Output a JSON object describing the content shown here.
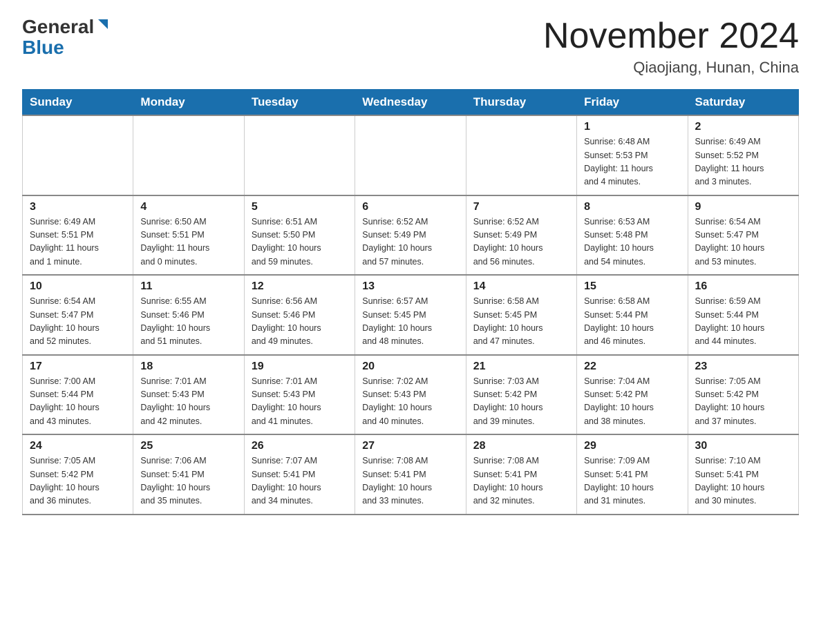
{
  "header": {
    "logo_general": "General",
    "logo_blue": "Blue",
    "month_title": "November 2024",
    "location": "Qiaojiang, Hunan, China"
  },
  "weekdays": [
    "Sunday",
    "Monday",
    "Tuesday",
    "Wednesday",
    "Thursday",
    "Friday",
    "Saturday"
  ],
  "weeks": [
    [
      {
        "day": "",
        "info": ""
      },
      {
        "day": "",
        "info": ""
      },
      {
        "day": "",
        "info": ""
      },
      {
        "day": "",
        "info": ""
      },
      {
        "day": "",
        "info": ""
      },
      {
        "day": "1",
        "info": "Sunrise: 6:48 AM\nSunset: 5:53 PM\nDaylight: 11 hours\nand 4 minutes."
      },
      {
        "day": "2",
        "info": "Sunrise: 6:49 AM\nSunset: 5:52 PM\nDaylight: 11 hours\nand 3 minutes."
      }
    ],
    [
      {
        "day": "3",
        "info": "Sunrise: 6:49 AM\nSunset: 5:51 PM\nDaylight: 11 hours\nand 1 minute."
      },
      {
        "day": "4",
        "info": "Sunrise: 6:50 AM\nSunset: 5:51 PM\nDaylight: 11 hours\nand 0 minutes."
      },
      {
        "day": "5",
        "info": "Sunrise: 6:51 AM\nSunset: 5:50 PM\nDaylight: 10 hours\nand 59 minutes."
      },
      {
        "day": "6",
        "info": "Sunrise: 6:52 AM\nSunset: 5:49 PM\nDaylight: 10 hours\nand 57 minutes."
      },
      {
        "day": "7",
        "info": "Sunrise: 6:52 AM\nSunset: 5:49 PM\nDaylight: 10 hours\nand 56 minutes."
      },
      {
        "day": "8",
        "info": "Sunrise: 6:53 AM\nSunset: 5:48 PM\nDaylight: 10 hours\nand 54 minutes."
      },
      {
        "day": "9",
        "info": "Sunrise: 6:54 AM\nSunset: 5:47 PM\nDaylight: 10 hours\nand 53 minutes."
      }
    ],
    [
      {
        "day": "10",
        "info": "Sunrise: 6:54 AM\nSunset: 5:47 PM\nDaylight: 10 hours\nand 52 minutes."
      },
      {
        "day": "11",
        "info": "Sunrise: 6:55 AM\nSunset: 5:46 PM\nDaylight: 10 hours\nand 51 minutes."
      },
      {
        "day": "12",
        "info": "Sunrise: 6:56 AM\nSunset: 5:46 PM\nDaylight: 10 hours\nand 49 minutes."
      },
      {
        "day": "13",
        "info": "Sunrise: 6:57 AM\nSunset: 5:45 PM\nDaylight: 10 hours\nand 48 minutes."
      },
      {
        "day": "14",
        "info": "Sunrise: 6:58 AM\nSunset: 5:45 PM\nDaylight: 10 hours\nand 47 minutes."
      },
      {
        "day": "15",
        "info": "Sunrise: 6:58 AM\nSunset: 5:44 PM\nDaylight: 10 hours\nand 46 minutes."
      },
      {
        "day": "16",
        "info": "Sunrise: 6:59 AM\nSunset: 5:44 PM\nDaylight: 10 hours\nand 44 minutes."
      }
    ],
    [
      {
        "day": "17",
        "info": "Sunrise: 7:00 AM\nSunset: 5:44 PM\nDaylight: 10 hours\nand 43 minutes."
      },
      {
        "day": "18",
        "info": "Sunrise: 7:01 AM\nSunset: 5:43 PM\nDaylight: 10 hours\nand 42 minutes."
      },
      {
        "day": "19",
        "info": "Sunrise: 7:01 AM\nSunset: 5:43 PM\nDaylight: 10 hours\nand 41 minutes."
      },
      {
        "day": "20",
        "info": "Sunrise: 7:02 AM\nSunset: 5:43 PM\nDaylight: 10 hours\nand 40 minutes."
      },
      {
        "day": "21",
        "info": "Sunrise: 7:03 AM\nSunset: 5:42 PM\nDaylight: 10 hours\nand 39 minutes."
      },
      {
        "day": "22",
        "info": "Sunrise: 7:04 AM\nSunset: 5:42 PM\nDaylight: 10 hours\nand 38 minutes."
      },
      {
        "day": "23",
        "info": "Sunrise: 7:05 AM\nSunset: 5:42 PM\nDaylight: 10 hours\nand 37 minutes."
      }
    ],
    [
      {
        "day": "24",
        "info": "Sunrise: 7:05 AM\nSunset: 5:42 PM\nDaylight: 10 hours\nand 36 minutes."
      },
      {
        "day": "25",
        "info": "Sunrise: 7:06 AM\nSunset: 5:41 PM\nDaylight: 10 hours\nand 35 minutes."
      },
      {
        "day": "26",
        "info": "Sunrise: 7:07 AM\nSunset: 5:41 PM\nDaylight: 10 hours\nand 34 minutes."
      },
      {
        "day": "27",
        "info": "Sunrise: 7:08 AM\nSunset: 5:41 PM\nDaylight: 10 hours\nand 33 minutes."
      },
      {
        "day": "28",
        "info": "Sunrise: 7:08 AM\nSunset: 5:41 PM\nDaylight: 10 hours\nand 32 minutes."
      },
      {
        "day": "29",
        "info": "Sunrise: 7:09 AM\nSunset: 5:41 PM\nDaylight: 10 hours\nand 31 minutes."
      },
      {
        "day": "30",
        "info": "Sunrise: 7:10 AM\nSunset: 5:41 PM\nDaylight: 10 hours\nand 30 minutes."
      }
    ]
  ]
}
